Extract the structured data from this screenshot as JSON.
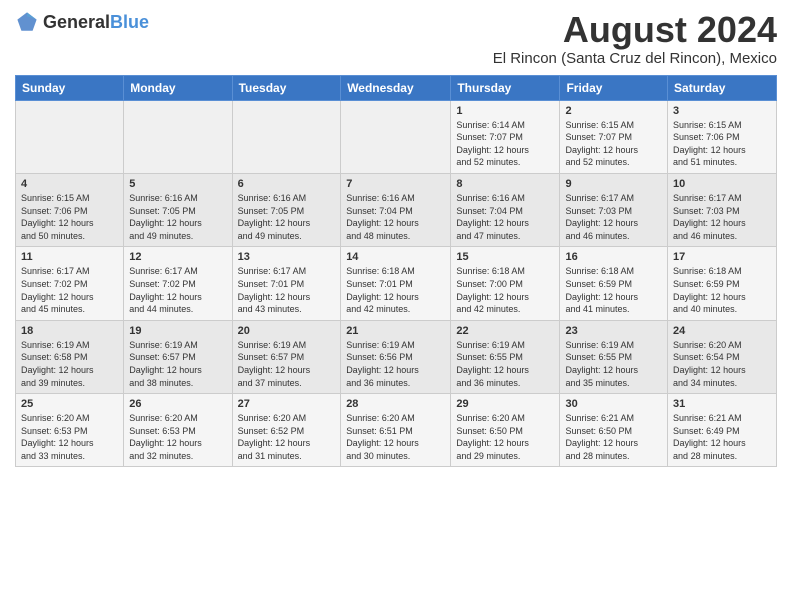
{
  "header": {
    "logo_general": "General",
    "logo_blue": "Blue",
    "month_year": "August 2024",
    "location": "El Rincon (Santa Cruz del Rincon), Mexico"
  },
  "days_of_week": [
    "Sunday",
    "Monday",
    "Tuesday",
    "Wednesday",
    "Thursday",
    "Friday",
    "Saturday"
  ],
  "weeks": [
    [
      {
        "day": "",
        "info": ""
      },
      {
        "day": "",
        "info": ""
      },
      {
        "day": "",
        "info": ""
      },
      {
        "day": "",
        "info": ""
      },
      {
        "day": "1",
        "info": "Sunrise: 6:14 AM\nSunset: 7:07 PM\nDaylight: 12 hours\nand 52 minutes."
      },
      {
        "day": "2",
        "info": "Sunrise: 6:15 AM\nSunset: 7:07 PM\nDaylight: 12 hours\nand 52 minutes."
      },
      {
        "day": "3",
        "info": "Sunrise: 6:15 AM\nSunset: 7:06 PM\nDaylight: 12 hours\nand 51 minutes."
      }
    ],
    [
      {
        "day": "4",
        "info": "Sunrise: 6:15 AM\nSunset: 7:06 PM\nDaylight: 12 hours\nand 50 minutes."
      },
      {
        "day": "5",
        "info": "Sunrise: 6:16 AM\nSunset: 7:05 PM\nDaylight: 12 hours\nand 49 minutes."
      },
      {
        "day": "6",
        "info": "Sunrise: 6:16 AM\nSunset: 7:05 PM\nDaylight: 12 hours\nand 49 minutes."
      },
      {
        "day": "7",
        "info": "Sunrise: 6:16 AM\nSunset: 7:04 PM\nDaylight: 12 hours\nand 48 minutes."
      },
      {
        "day": "8",
        "info": "Sunrise: 6:16 AM\nSunset: 7:04 PM\nDaylight: 12 hours\nand 47 minutes."
      },
      {
        "day": "9",
        "info": "Sunrise: 6:17 AM\nSunset: 7:03 PM\nDaylight: 12 hours\nand 46 minutes."
      },
      {
        "day": "10",
        "info": "Sunrise: 6:17 AM\nSunset: 7:03 PM\nDaylight: 12 hours\nand 46 minutes."
      }
    ],
    [
      {
        "day": "11",
        "info": "Sunrise: 6:17 AM\nSunset: 7:02 PM\nDaylight: 12 hours\nand 45 minutes."
      },
      {
        "day": "12",
        "info": "Sunrise: 6:17 AM\nSunset: 7:02 PM\nDaylight: 12 hours\nand 44 minutes."
      },
      {
        "day": "13",
        "info": "Sunrise: 6:17 AM\nSunset: 7:01 PM\nDaylight: 12 hours\nand 43 minutes."
      },
      {
        "day": "14",
        "info": "Sunrise: 6:18 AM\nSunset: 7:01 PM\nDaylight: 12 hours\nand 42 minutes."
      },
      {
        "day": "15",
        "info": "Sunrise: 6:18 AM\nSunset: 7:00 PM\nDaylight: 12 hours\nand 42 minutes."
      },
      {
        "day": "16",
        "info": "Sunrise: 6:18 AM\nSunset: 6:59 PM\nDaylight: 12 hours\nand 41 minutes."
      },
      {
        "day": "17",
        "info": "Sunrise: 6:18 AM\nSunset: 6:59 PM\nDaylight: 12 hours\nand 40 minutes."
      }
    ],
    [
      {
        "day": "18",
        "info": "Sunrise: 6:19 AM\nSunset: 6:58 PM\nDaylight: 12 hours\nand 39 minutes."
      },
      {
        "day": "19",
        "info": "Sunrise: 6:19 AM\nSunset: 6:57 PM\nDaylight: 12 hours\nand 38 minutes."
      },
      {
        "day": "20",
        "info": "Sunrise: 6:19 AM\nSunset: 6:57 PM\nDaylight: 12 hours\nand 37 minutes."
      },
      {
        "day": "21",
        "info": "Sunrise: 6:19 AM\nSunset: 6:56 PM\nDaylight: 12 hours\nand 36 minutes."
      },
      {
        "day": "22",
        "info": "Sunrise: 6:19 AM\nSunset: 6:55 PM\nDaylight: 12 hours\nand 36 minutes."
      },
      {
        "day": "23",
        "info": "Sunrise: 6:19 AM\nSunset: 6:55 PM\nDaylight: 12 hours\nand 35 minutes."
      },
      {
        "day": "24",
        "info": "Sunrise: 6:20 AM\nSunset: 6:54 PM\nDaylight: 12 hours\nand 34 minutes."
      }
    ],
    [
      {
        "day": "25",
        "info": "Sunrise: 6:20 AM\nSunset: 6:53 PM\nDaylight: 12 hours\nand 33 minutes."
      },
      {
        "day": "26",
        "info": "Sunrise: 6:20 AM\nSunset: 6:53 PM\nDaylight: 12 hours\nand 32 minutes."
      },
      {
        "day": "27",
        "info": "Sunrise: 6:20 AM\nSunset: 6:52 PM\nDaylight: 12 hours\nand 31 minutes."
      },
      {
        "day": "28",
        "info": "Sunrise: 6:20 AM\nSunset: 6:51 PM\nDaylight: 12 hours\nand 30 minutes."
      },
      {
        "day": "29",
        "info": "Sunrise: 6:20 AM\nSunset: 6:50 PM\nDaylight: 12 hours\nand 29 minutes."
      },
      {
        "day": "30",
        "info": "Sunrise: 6:21 AM\nSunset: 6:50 PM\nDaylight: 12 hours\nand 28 minutes."
      },
      {
        "day": "31",
        "info": "Sunrise: 6:21 AM\nSunset: 6:49 PM\nDaylight: 12 hours\nand 28 minutes."
      }
    ]
  ]
}
